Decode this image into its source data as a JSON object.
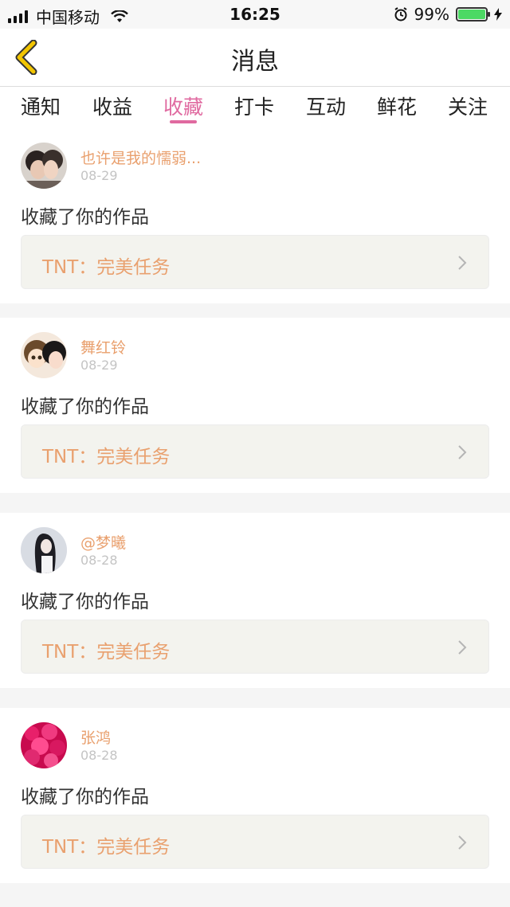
{
  "status_bar": {
    "carrier": "中国移动",
    "time": "16:25",
    "battery": "99%",
    "battery_level": 0.99
  },
  "nav": {
    "title": "消息"
  },
  "tabs": [
    {
      "label": "通知",
      "active": false
    },
    {
      "label": "收益",
      "active": false
    },
    {
      "label": "收藏",
      "active": true
    },
    {
      "label": "打卡",
      "active": false
    },
    {
      "label": "互动",
      "active": false
    },
    {
      "label": "鲜花",
      "active": false
    },
    {
      "label": "关注",
      "active": false
    }
  ],
  "notifications": [
    {
      "username": "也许是我的懦弱...",
      "date": "08-29",
      "action": "收藏了你的作品",
      "work_title": "TNT：完美任务"
    },
    {
      "username": "舞红铃",
      "date": "08-29",
      "action": "收藏了你的作品",
      "work_title": "TNT：完美任务"
    },
    {
      "username": "@梦曦",
      "date": "08-28",
      "action": "收藏了你的作品",
      "work_title": "TNT：完美任务"
    },
    {
      "username": "张鸿",
      "date": "08-28",
      "action": "收藏了你的作品",
      "work_title": "TNT：完美任务"
    }
  ],
  "colors": {
    "accent": "#e06aa0",
    "username": "#e9a06e",
    "back_icon": "#f2c500",
    "battery": "#4cd964"
  }
}
